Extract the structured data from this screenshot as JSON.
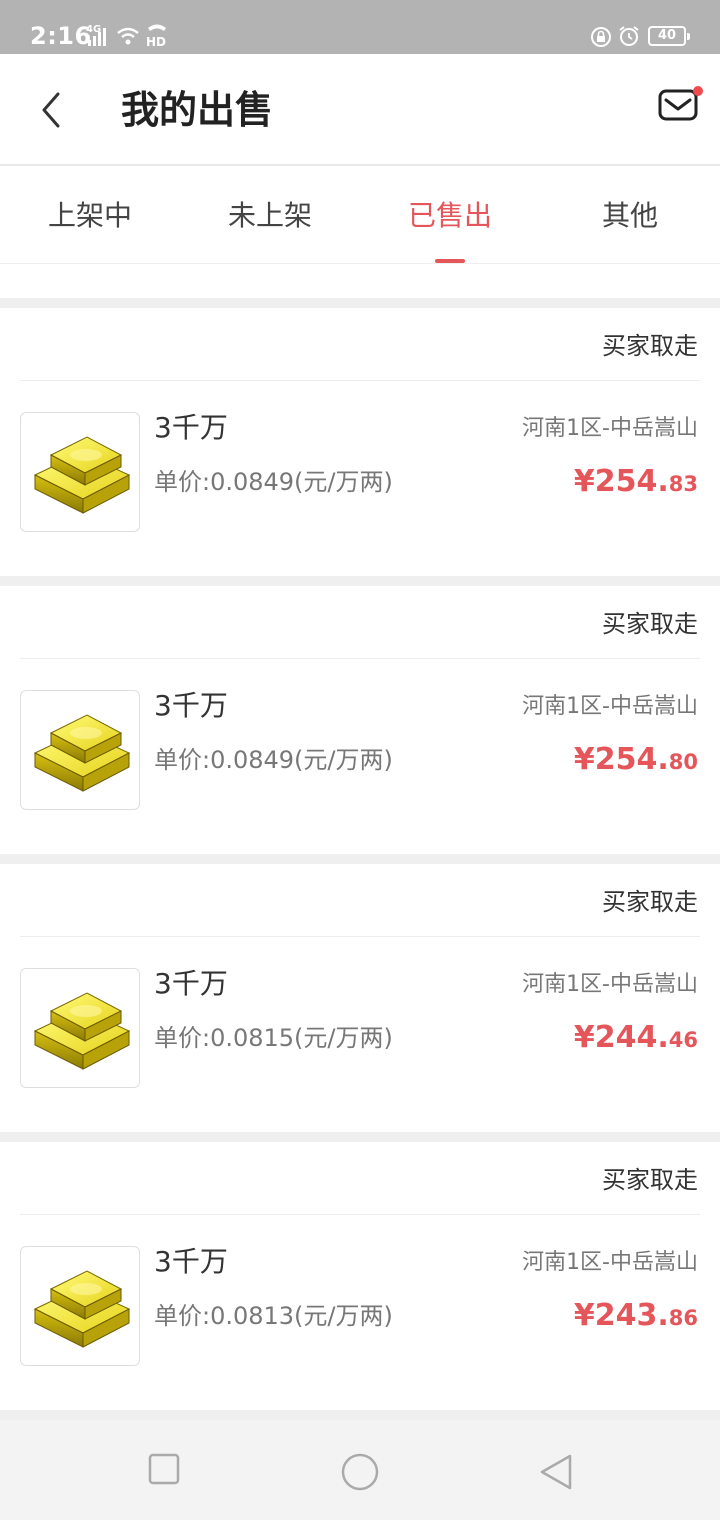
{
  "status_bar": {
    "time": "2:16",
    "network": "4G",
    "battery": "40",
    "icons": [
      "signal-icon",
      "wifi-icon",
      "hd-call-icon",
      "lock-icon",
      "alarm-icon",
      "battery-icon"
    ]
  },
  "header": {
    "title": "我的出售",
    "back_icon": "chevron-left-icon",
    "mail_icon": "mail-icon",
    "has_unread": true
  },
  "tabs": [
    {
      "label": "上架中",
      "active": false
    },
    {
      "label": "未上架",
      "active": false
    },
    {
      "label": "已售出",
      "active": true
    },
    {
      "label": "其他",
      "active": false
    }
  ],
  "orders": [
    {
      "status": "买家取走",
      "amount": "3千万",
      "unit_price": "单价:0.0849(元/万两)",
      "server": "河南1区-中岳嵩山",
      "price_main": "¥254.",
      "price_cents": "83"
    },
    {
      "status": "买家取走",
      "amount": "3千万",
      "unit_price": "单价:0.0849(元/万两)",
      "server": "河南1区-中岳嵩山",
      "price_main": "¥254.",
      "price_cents": "80"
    },
    {
      "status": "买家取走",
      "amount": "3千万",
      "unit_price": "单价:0.0815(元/万两)",
      "server": "河南1区-中岳嵩山",
      "price_main": "¥244.",
      "price_cents": "46"
    },
    {
      "status": "买家取走",
      "amount": "3千万",
      "unit_price": "单价:0.0813(元/万两)",
      "server": "河南1区-中岳嵩山",
      "price_main": "¥243.",
      "price_cents": "86"
    }
  ],
  "system_nav": [
    "recents-square-icon",
    "home-circle-icon",
    "back-triangle-icon"
  ],
  "colors": {
    "accent": "#e5565b",
    "status_bar": "#b3b3b3",
    "separator": "#efefef"
  }
}
